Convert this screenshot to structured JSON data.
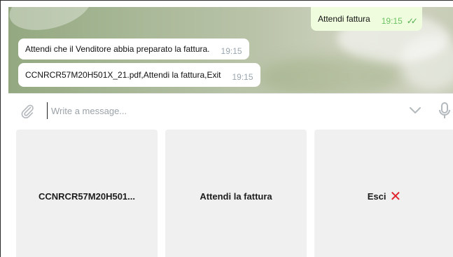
{
  "chat": {
    "outgoing": {
      "text": "Attendi fattura",
      "time": "19:15",
      "status_icon": "double-check-icon"
    },
    "incoming": [
      {
        "text": "Attendi che il Venditore abbia preparato la fattura.",
        "time": "19:15"
      },
      {
        "text": "CCNRCR57M20H501X_21.pdf,Attendi la fattura,Exit",
        "time": "19:15"
      }
    ]
  },
  "input": {
    "placeholder": "Write a message...",
    "value": ""
  },
  "icons": {
    "attach": "paperclip-icon",
    "collapse": "chevron-down-icon",
    "voice": "microphone-icon",
    "exit": "red-x-icon"
  },
  "keyboard": {
    "buttons": [
      {
        "label": "CCNRCR57M20H501..."
      },
      {
        "label": "Attendi la fattura"
      },
      {
        "label": "Esci",
        "icon": "❌"
      }
    ]
  },
  "colors": {
    "outgoing_bubble": "#effdde",
    "incoming_bubble": "#ffffff",
    "keyboard_button": "#f0f0f0",
    "exit_icon": "#e0242e"
  }
}
